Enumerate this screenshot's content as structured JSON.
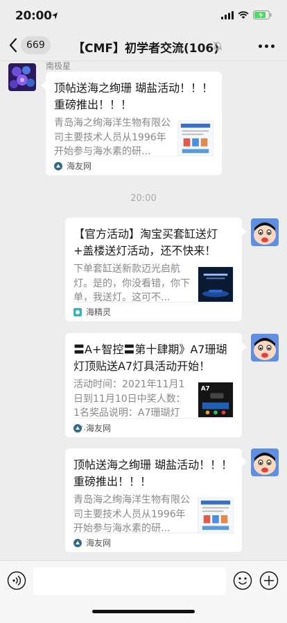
{
  "status_bar": {
    "time": "20:00"
  },
  "nav": {
    "unread_count": "669",
    "title": "【CMF】初学者交流(106)"
  },
  "timestamp": "20:00",
  "messages": [
    {
      "side": "left",
      "sender": "南极星",
      "title": "顶帖送海之绚珊 瑚盐活动！！！ 重磅推出！！！",
      "desc": "青岛海之绚海洋生物有限公司主要技术人员从1996年开始参与海水素的研...",
      "source": "海友网"
    },
    {
      "side": "right",
      "title": "【官方活动】淘宝买套缸送灯+盖楼送灯活动，还不快来！",
      "desc": "下单套缸送新款迈光启航灯。是的，你没看错，你下单，我送灯。这可不...",
      "source": "海精灵"
    },
    {
      "side": "right",
      "title": "〓A+智控〓第十肆期》A7珊瑚灯顶贴送A7灯具活动开始！",
      "desc": "活动时间：2021年11月1日到11月10日中奖人数：1名奖品说明：A7珊瑚灯一...",
      "source": "海友网",
      "thumb_text": "A7"
    },
    {
      "side": "right",
      "title": "顶帖送海之绚珊 瑚盐活动！！！ 重磅推出！！！",
      "desc": "青岛海之绚海洋生物有限公司主要技术人员从1996年开始参与海水素的研...",
      "source": "海友网"
    }
  ],
  "colors": {
    "background": "#ededed",
    "card": "#ffffff",
    "secondary_text": "#888888",
    "battery": "#4cd964"
  }
}
